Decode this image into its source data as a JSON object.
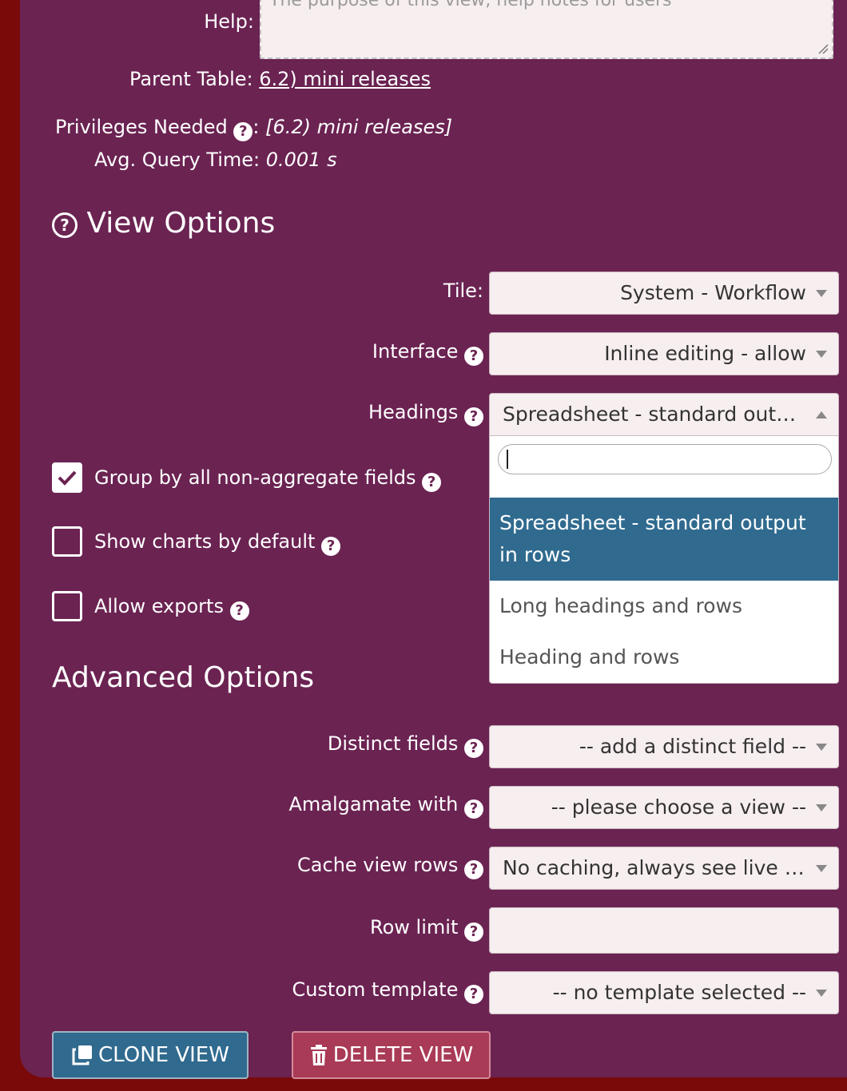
{
  "help": {
    "label": "Help:",
    "placeholder": "The purpose of this view, help notes for users"
  },
  "parent_table": {
    "label": "Parent Table:",
    "value": "6.2) mini releases"
  },
  "privileges": {
    "label": "Privileges Needed",
    "separator": ":",
    "value": "[6.2) mini releases]"
  },
  "query_time": {
    "label": "Avg. Query Time:",
    "value": "0.001 s"
  },
  "view_options": {
    "title": "View Options",
    "tile": {
      "label": "Tile:",
      "value": "System - Workflow"
    },
    "interface": {
      "label": "Interface",
      "value": "Inline editing - allow"
    },
    "headings": {
      "label": "Headings",
      "value": "Spreadsheet - standard outp...",
      "search_value": "",
      "options": [
        {
          "label": "Spreadsheet - standard output in rows",
          "selected": true
        },
        {
          "label": "Long headings and rows",
          "selected": false
        },
        {
          "label": "Heading and rows",
          "selected": false
        }
      ]
    },
    "group_by": {
      "label": "Group by all non-aggregate fields",
      "checked": true
    },
    "show_charts": {
      "label": "Show charts by default",
      "checked": false
    },
    "allow_exports": {
      "label": "Allow exports",
      "checked": false
    }
  },
  "advanced_options": {
    "title": "Advanced Options",
    "distinct_fields": {
      "label": "Distinct fields",
      "value": "-- add a distinct field --"
    },
    "amalgamate_with": {
      "label": "Amalgamate with",
      "value": "-- please choose a view --"
    },
    "cache_view_rows": {
      "label": "Cache view rows",
      "value": "No caching, always see live d..."
    },
    "row_limit": {
      "label": "Row limit",
      "value": ""
    },
    "custom_template": {
      "label": "Custom template",
      "value": "-- no template selected --"
    }
  },
  "buttons": {
    "clone": "CLONE VIEW",
    "delete": "DELETE VIEW"
  },
  "colors": {
    "panel": "#6b2352",
    "page_background": "#7a0a0a",
    "selected_option": "#306a8f",
    "clone_button": "#306a8f",
    "delete_button": "#a93b56"
  }
}
